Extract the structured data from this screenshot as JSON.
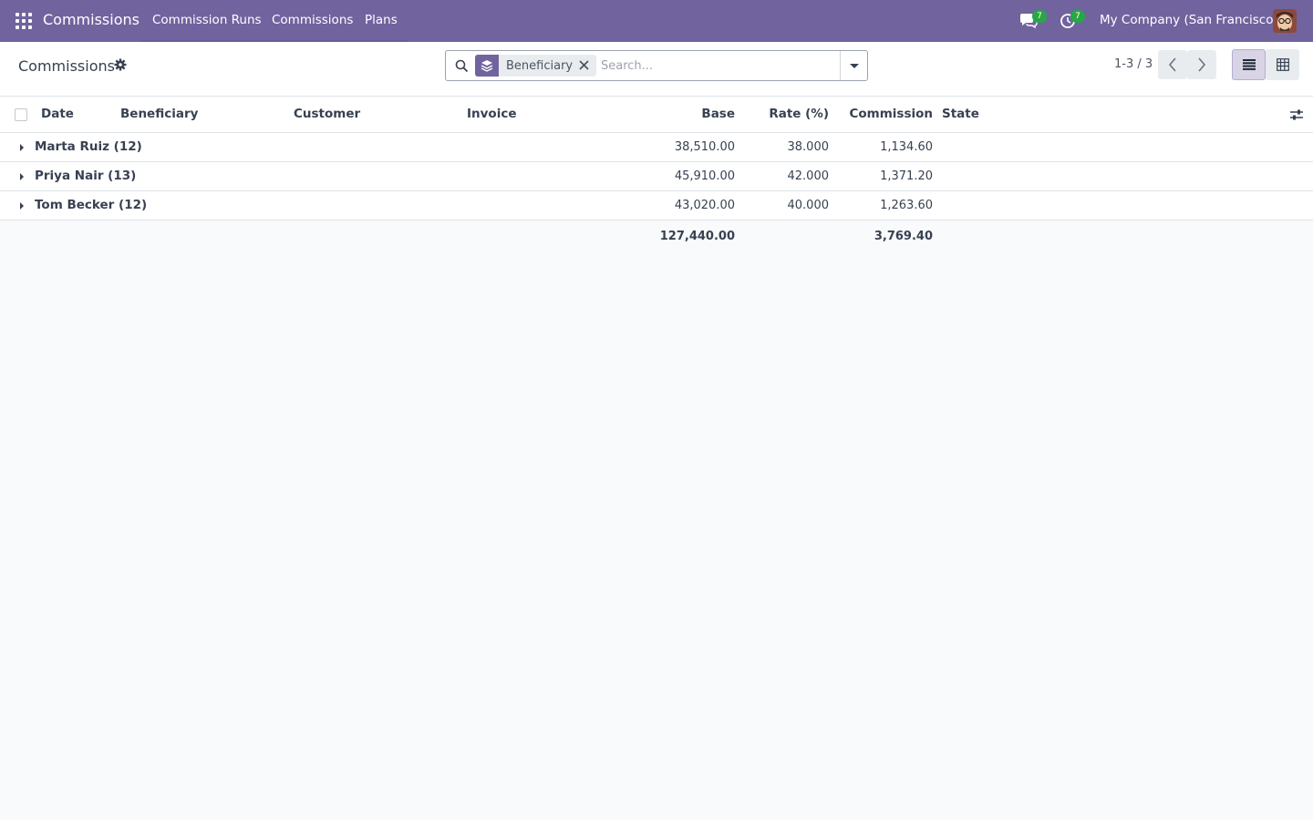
{
  "navbar": {
    "app_name": "Commissions",
    "menu": [
      "Commission Runs",
      "Commissions",
      "Plans"
    ],
    "messages_badge": "7",
    "activities_badge": "7",
    "company": "My Company (San Francisco)",
    "brand_color": "#71639e"
  },
  "control": {
    "title": "Commissions",
    "search": {
      "facet_label": "Beneficiary",
      "placeholder": "Search..."
    },
    "pager": "1-3 / 3"
  },
  "table": {
    "columns": [
      "Date",
      "Beneficiary",
      "Customer",
      "Invoice",
      "Base",
      "Rate (%)",
      "Commission",
      "State"
    ],
    "groups": [
      {
        "name": "Marta Ruiz (12)",
        "base": "38,510.00",
        "rate": "38.000",
        "commission": "1,134.60"
      },
      {
        "name": "Priya Nair (13)",
        "base": "45,910.00",
        "rate": "42.000",
        "commission": "1,371.20"
      },
      {
        "name": "Tom Becker (12)",
        "base": "43,020.00",
        "rate": "40.000",
        "commission": "1,263.60"
      }
    ],
    "totals": {
      "base": "127,440.00",
      "commission": "3,769.40"
    }
  }
}
